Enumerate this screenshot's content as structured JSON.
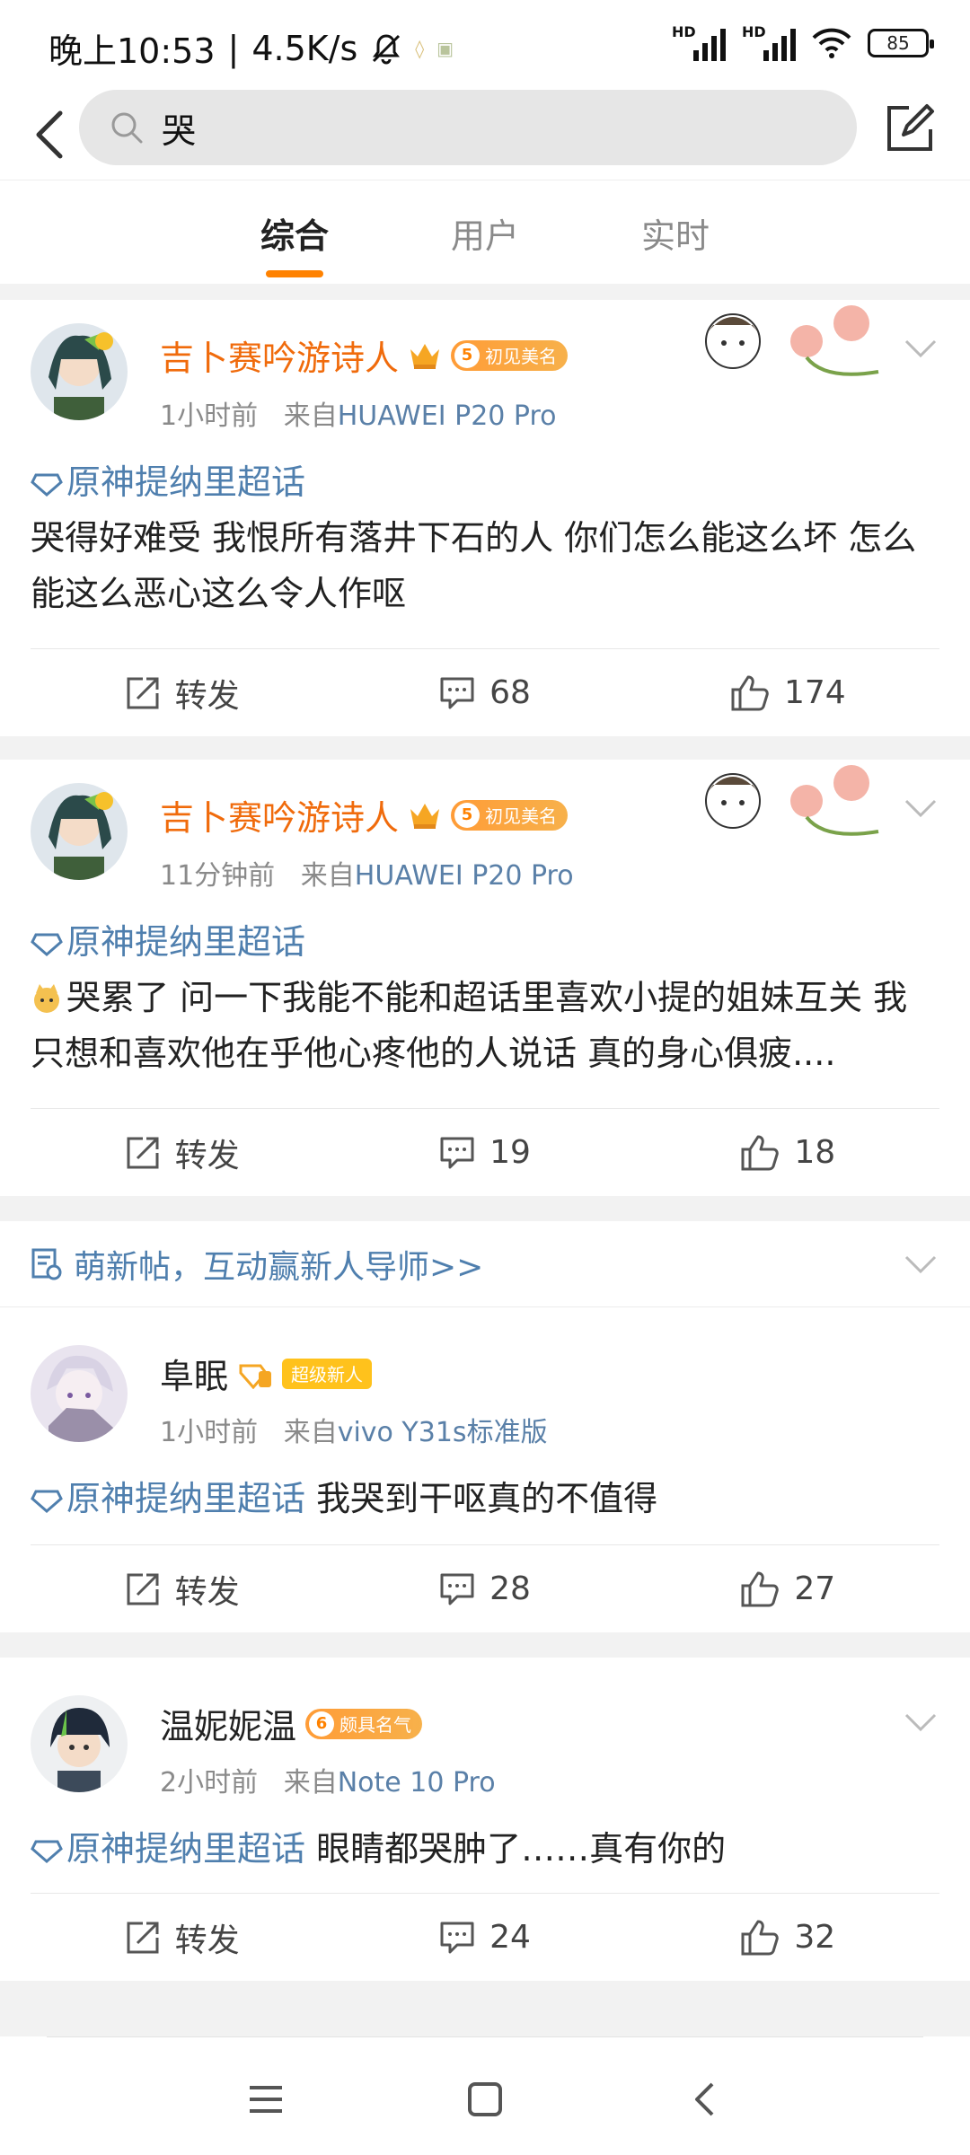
{
  "status": {
    "time": "晚上10:53",
    "speed": "4.5K/s",
    "hd1": "HD",
    "hd2": "HD",
    "battery": "85"
  },
  "search": {
    "query": "哭"
  },
  "tabs": [
    "综合",
    "用户",
    "实时"
  ],
  "active_tab": "综合",
  "posts": [
    {
      "username": "吉卜赛吟游诗人",
      "level": "5",
      "badge": "初见美名",
      "time": "1小时前",
      "from_prefix": "来自",
      "device": "HUAWEI P20 Pro",
      "topic": "原神提纳里超话",
      "text": "哭得好难受 我恨所有落井下石的人 你们怎么能这么坏 怎么能这么恶心这么令人作呕",
      "repost": "转发",
      "comments": "68",
      "likes": "174"
    },
    {
      "username": "吉卜赛吟游诗人",
      "level": "5",
      "badge": "初见美名",
      "time": "11分钟前",
      "from_prefix": "来自",
      "device": "HUAWEI P20 Pro",
      "topic": "原神提纳里超话",
      "text": "哭累了 问一下我能不能和超话里喜欢小提的姐妹互关 我只想和喜欢他在乎他心疼他的人说话 真的身心俱疲....",
      "repost": "转发",
      "comments": "19",
      "likes": "18"
    },
    {
      "username": "阜眠",
      "badge": "超级新人",
      "time": "1小时前",
      "from_prefix": "来自",
      "device": "vivo Y31s标准版",
      "topic": "原神提纳里超话",
      "text": "我哭到干呕真的不值得",
      "repost": "转发",
      "comments": "28",
      "likes": "27"
    },
    {
      "username": "温妮妮温",
      "level": "6",
      "badge": "颇具名气",
      "time": "2小时前",
      "from_prefix": "来自",
      "device": "Note 10 Pro",
      "topic": "原神提纳里超话",
      "text": "眼睛都哭肿了……真有你的",
      "repost": "转发",
      "comments": "24",
      "likes": "32"
    }
  ],
  "promo": {
    "text": "萌新帖，互动赢新人导师>>"
  },
  "colors": {
    "accent": "#ff8200",
    "vip_name": "#f06b0c",
    "link": "#4f7fae"
  }
}
